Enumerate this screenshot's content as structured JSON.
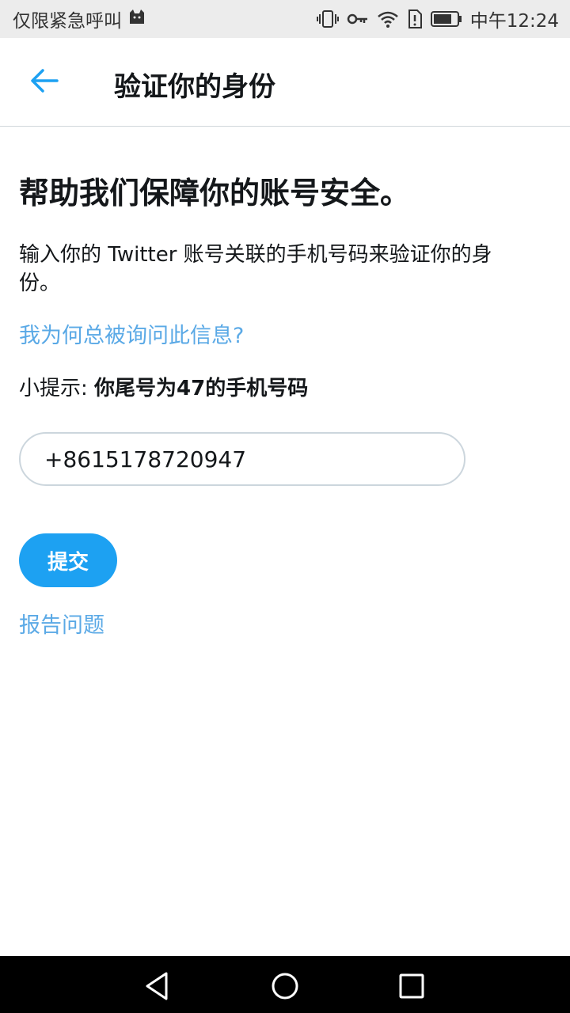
{
  "status_bar": {
    "carrier_text": "仅限紧急呼叫",
    "time": "中午12:24",
    "icons": [
      "cat-notification-icon",
      "vibrate-icon",
      "key-icon",
      "wifi-icon",
      "alert-icon",
      "battery-icon"
    ]
  },
  "app_bar": {
    "back_icon": "arrow-left-icon",
    "title": "验证你的身份"
  },
  "main": {
    "headline": "帮助我们保障你的账号安全。",
    "description": "输入你的 Twitter 账号关联的手机号码来验证你的身份。",
    "why_link": "我为何总被询问此信息?",
    "hint_prefix": "小提示: ",
    "hint_bold": "你尾号为47的手机号码",
    "phone_value": "+8615178720947",
    "submit_label": "提交",
    "report_link": "报告问题"
  },
  "nav_bar": {
    "icons": [
      "back-triangle-icon",
      "home-circle-icon",
      "recents-square-icon"
    ]
  },
  "colors": {
    "accent": "#1da1f2",
    "link": "#5aa9e6",
    "text": "#14171a",
    "status_bar_bg": "#ececec",
    "input_border": "#ccd6dd"
  }
}
